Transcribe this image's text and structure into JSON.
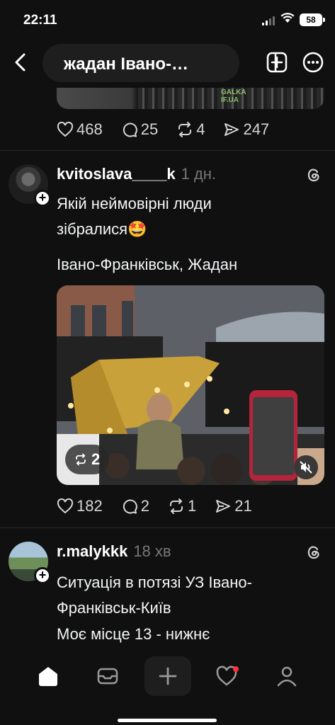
{
  "status_bar": {
    "time": "22:11",
    "battery": "58"
  },
  "header": {
    "search_query": "жадан Івано-…"
  },
  "top_post": {
    "image_sign_text": "GALKA\nIF.UA",
    "actions": {
      "likes": "468",
      "comments": "25",
      "reposts": "4",
      "shares": "247"
    }
  },
  "post1": {
    "username": "kvitoslava____k",
    "time": "1 дн.",
    "text_line1": "Якій неймовірні люди",
    "text_line2": "зібралися🤩",
    "text_line3": "Івано-Франківськ, Жадан",
    "media_repost_count": "2",
    "actions": {
      "likes": "182",
      "comments": "2",
      "reposts": "1",
      "shares": "21"
    }
  },
  "post2": {
    "username": "r.malykkk",
    "time": "18 хв",
    "text_line1": "Ситуація в потязі УЗ Івано-",
    "text_line2": "Франківськ-Київ",
    "text_line3": "Моє місце 13 - нижнє"
  },
  "icons": {
    "back": "chevron-left-icon",
    "new_post": "compose-icon",
    "more": "ellipsis-icon",
    "like": "heart-icon",
    "comment": "comment-icon",
    "repost": "repost-icon",
    "share": "send-icon",
    "threads": "threads-logo-icon",
    "nav": [
      "home-icon",
      "inbox-icon",
      "plus-icon",
      "activity-heart-icon",
      "profile-icon"
    ]
  },
  "colors": {
    "background": "#101010",
    "notification_dot": "#ff3040",
    "secondary_text": "#777777"
  }
}
